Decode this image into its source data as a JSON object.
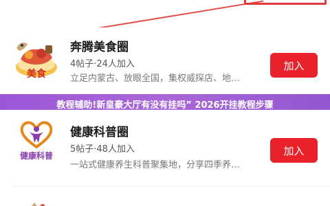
{
  "banner": {
    "text": "教程辅助!新皇豪大厅有没有挂吗” 2026开挂教程步骤"
  },
  "groups": [
    {
      "name": "奔腾美食圈",
      "stats": "4帖子·24人加入",
      "description": "立足内蒙古、放眼全国，集权威探店、地…",
      "join_label": "加入",
      "logo_text": "美食"
    },
    {
      "name": "健康科普圈",
      "stats": "5帖子·48人加入",
      "description": "一站式健康养生科普聚集地，分享四季养…",
      "join_label": "加入",
      "logo_text": "健康科普"
    }
  ],
  "colors": {
    "accent": "#e8212a",
    "banner": "#9b57d6",
    "health_logo": "#e8861a"
  },
  "icons": [
    "food-logo-icon",
    "health-logo-icon"
  ]
}
